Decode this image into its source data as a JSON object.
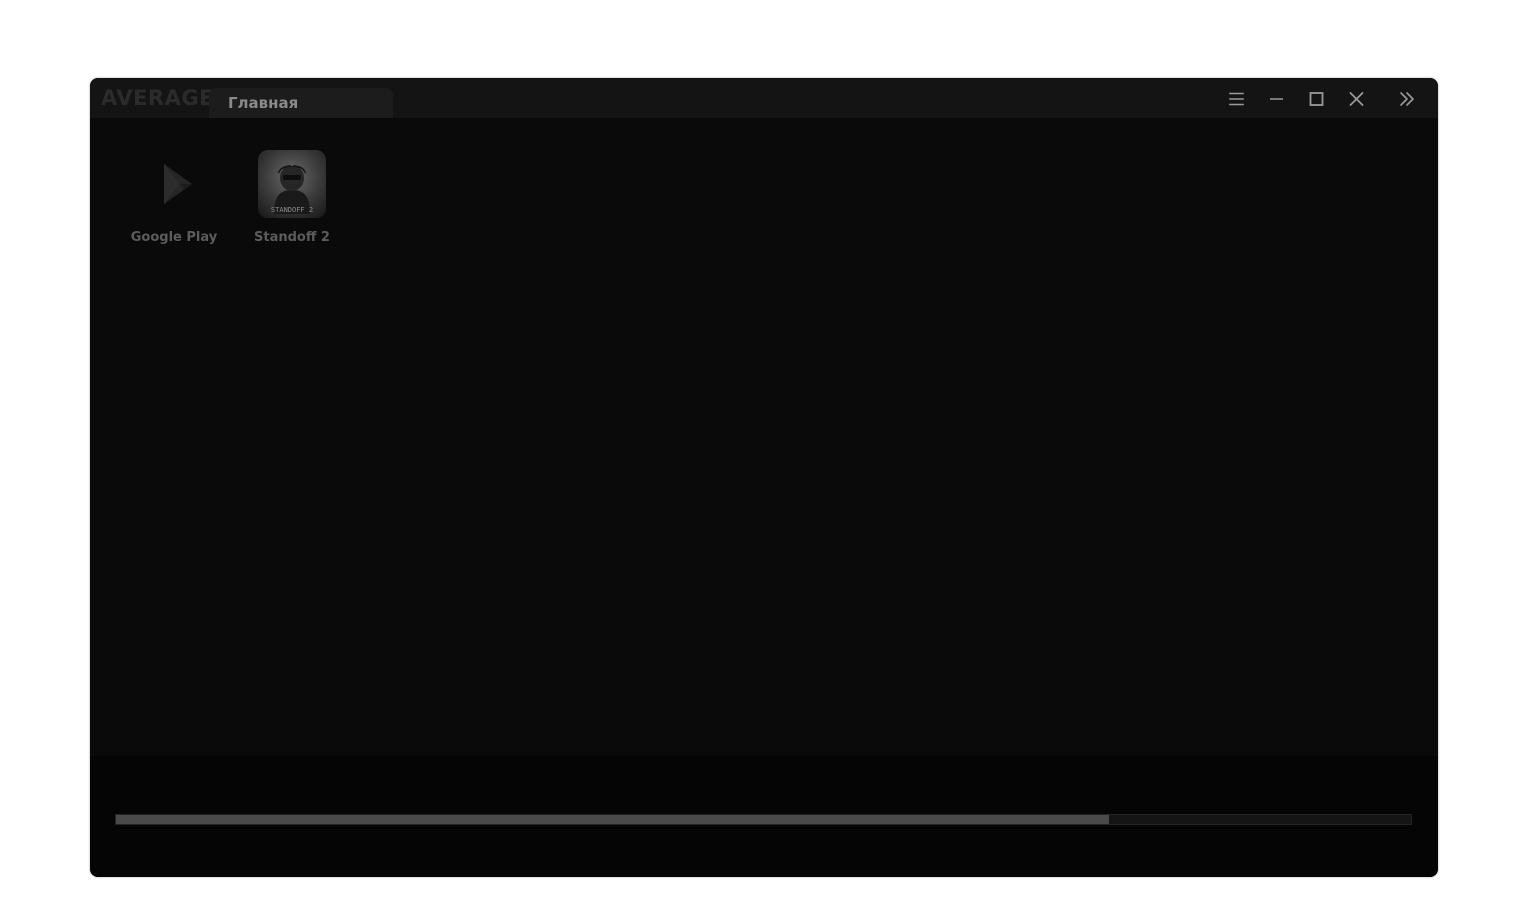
{
  "window": {
    "logo": "AVERAGE",
    "active_tab": "Главная"
  },
  "controls": {
    "menu_icon": "hamburger-menu-icon",
    "minimize_icon": "minimize-icon",
    "maximize_icon": "maximize-icon",
    "close_icon": "close-icon",
    "expand_icon": "double-chevron-right-icon"
  },
  "apps": [
    {
      "label": "Google Play",
      "icon": "google-play-icon"
    },
    {
      "label": "Standoff 2",
      "icon": "standoff-2-icon",
      "icon_text": "STANDOFF 2"
    }
  ],
  "progress": {
    "fraction": 0.767
  },
  "colors": {
    "window_bg": "#0a0a0a",
    "titlebar_bg": "#141414",
    "tab_bg": "#1c1c1c",
    "progress_fill": "#4a4a4a"
  }
}
